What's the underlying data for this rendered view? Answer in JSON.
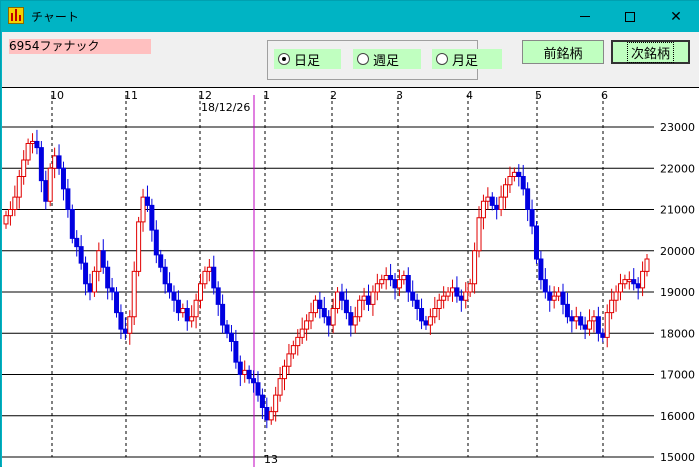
{
  "window": {
    "title": "チャート",
    "minimize": "—",
    "maximize": "☐",
    "close": "✕"
  },
  "toolbar": {
    "stock": "6954ファナック",
    "period_options": [
      {
        "label": "日足",
        "selected": true
      },
      {
        "label": "週足",
        "selected": false
      },
      {
        "label": "月足",
        "selected": false
      }
    ],
    "prev_button": "前銘柄",
    "next_button": "次銘柄"
  },
  "colors": {
    "up_candle": "#e00000",
    "down_candle": "#0000e0",
    "cursor_line": "#c000c0",
    "stock_label_bg": "#ffc0c0",
    "button_bg": "#c0ffc0"
  },
  "chart_data": {
    "type": "candlestick",
    "y_ticks": [
      "23000",
      "22000",
      "21000",
      "20000",
      "19000",
      "18000",
      "17000",
      "16000",
      "15000"
    ],
    "ylim": [
      15000,
      23000
    ],
    "month_labels": [
      "10",
      "11",
      "12",
      "1",
      "2",
      "3",
      "4",
      "5",
      "6"
    ],
    "cursor_date": "18/12/26",
    "cursor_value": "13",
    "grid": true,
    "close_series": [
      20850,
      21000,
      21300,
      21800,
      22200,
      22600,
      22650,
      22500,
      21700,
      21200,
      22000,
      22300,
      22000,
      21500,
      21000,
      20300,
      20100,
      19700,
      19200,
      19000,
      19500,
      20000,
      19600,
      19100,
      19000,
      18500,
      18100,
      18000,
      18400,
      19500,
      20700,
      21300,
      21100,
      20500,
      19900,
      19600,
      19200,
      19000,
      18800,
      18500,
      18600,
      18300,
      18400,
      18800,
      19200,
      19500,
      19600,
      19100,
      18700,
      18200,
      18000,
      17800,
      17300,
      17000,
      17100,
      16900,
      16800,
      16500,
      16200,
      15900,
      16100,
      16500,
      16900,
      17200,
      17500,
      17700,
      17900,
      18100,
      18300,
      18500,
      18800,
      18600,
      18400,
      18200,
      18600,
      19000,
      18800,
      18500,
      18200,
      18400,
      18800,
      18900,
      18700,
      19000,
      19200,
      19300,
      19400,
      19300,
      19100,
      19300,
      19400,
      19000,
      18800,
      18600,
      18300,
      18200,
      18400,
      18600,
      18800,
      18900,
      19000,
      19100,
      18900,
      18800,
      19000,
      19200,
      20000,
      20800,
      21200,
      21300,
      21100,
      21000,
      21300,
      21600,
      21800,
      21900,
      21800,
      21500,
      21000,
      20600,
      19800,
      19300,
      19000,
      18800,
      18900,
      19000,
      18700,
      18400,
      18300,
      18400,
      18200,
      18100,
      18300,
      18400,
      18000,
      17900,
      18500,
      18800,
      19000,
      19200,
      19300,
      19300,
      19200,
      19100,
      19500,
      19800
    ]
  }
}
